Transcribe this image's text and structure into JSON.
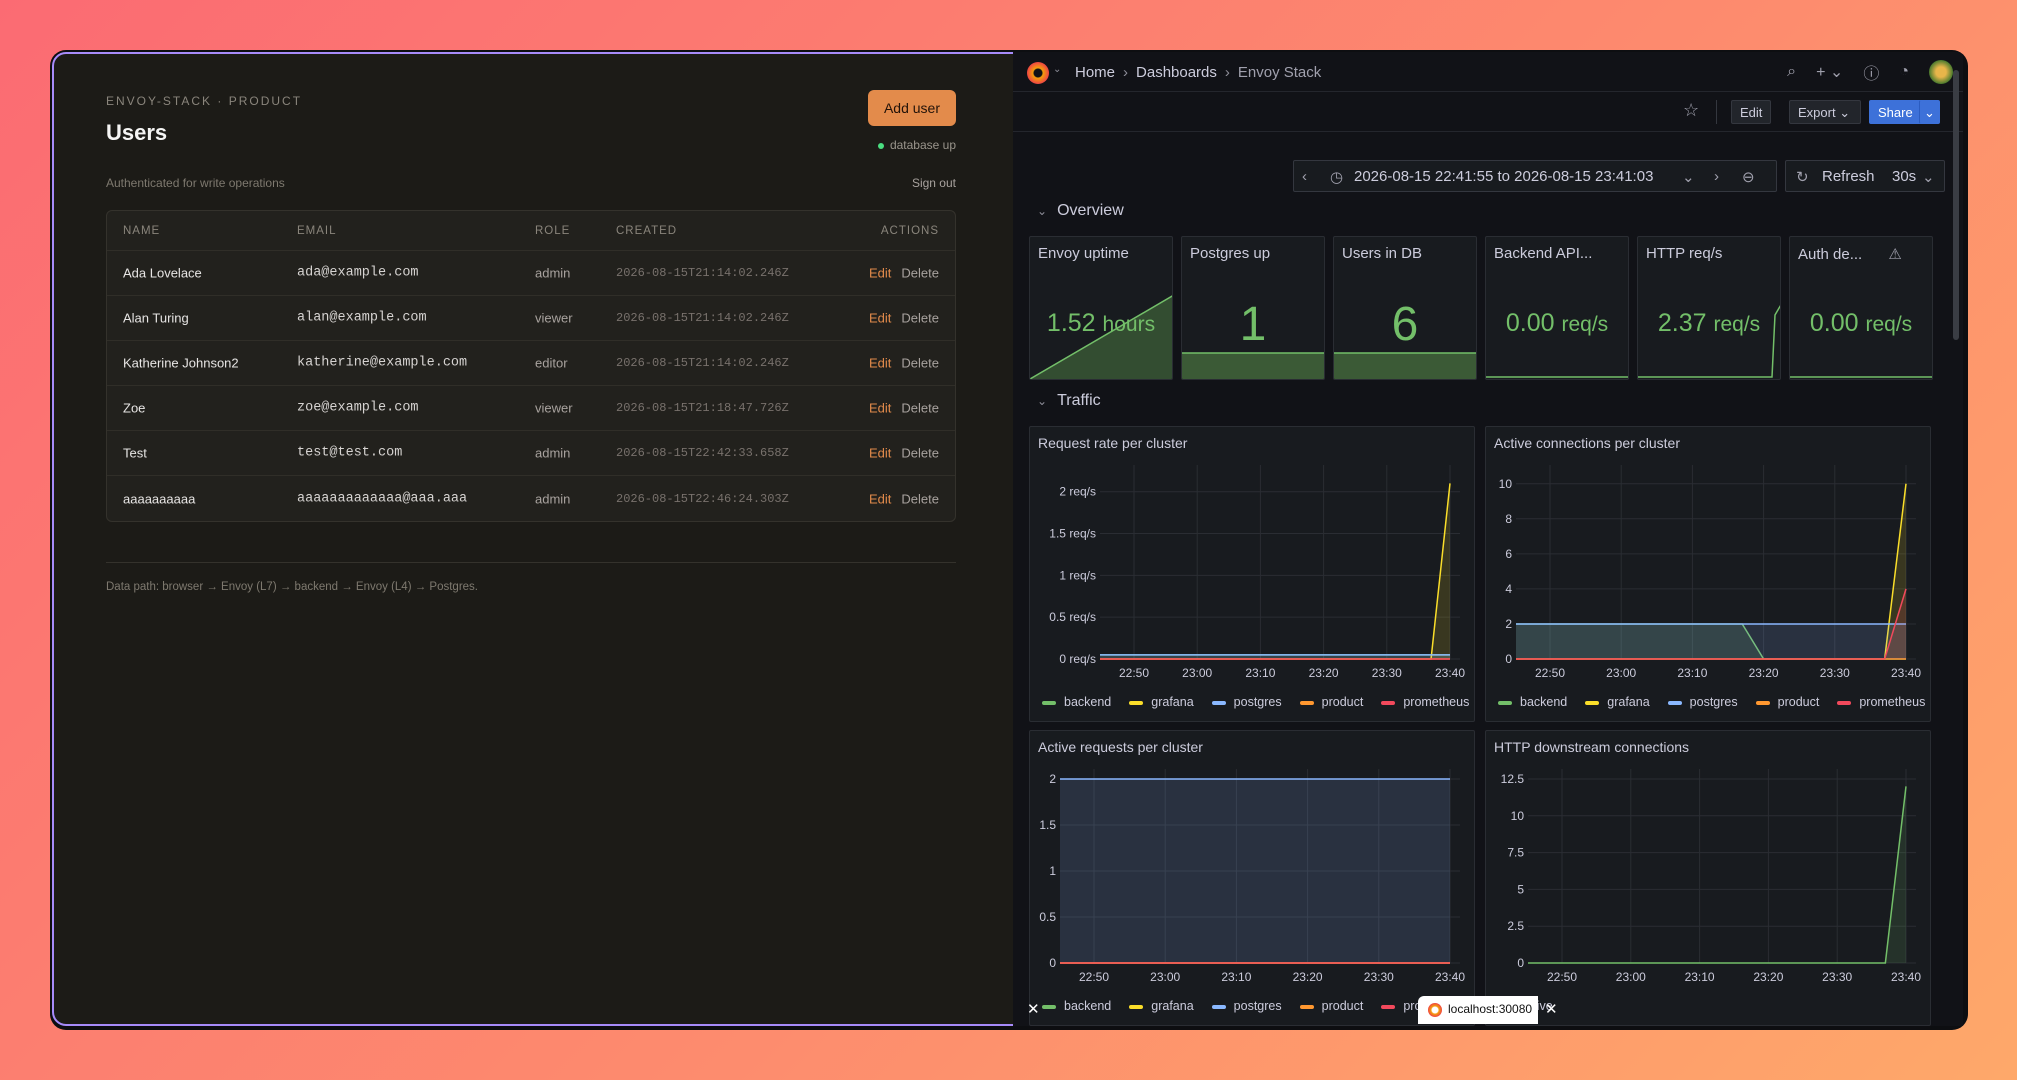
{
  "left": {
    "eyebrow": "ENVOY-STACK · PRODUCT",
    "title": "Users",
    "add_user": "Add user",
    "db_status": "database up",
    "auth_note": "Authenticated for write operations",
    "sign_out": "Sign out",
    "columns": [
      "NAME",
      "EMAIL",
      "ROLE",
      "CREATED",
      "ACTIONS"
    ],
    "rows": [
      {
        "name": "Ada Lovelace",
        "email": "ada@example.com",
        "role": "admin",
        "created": "2026-08-15T21:14:02.246Z"
      },
      {
        "name": "Alan Turing",
        "email": "alan@example.com",
        "role": "viewer",
        "created": "2026-08-15T21:14:02.246Z"
      },
      {
        "name": "Katherine Johnson2",
        "email": "katherine@example.com",
        "role": "editor",
        "created": "2026-08-15T21:14:02.246Z"
      },
      {
        "name": "Zoe",
        "email": "zoe@example.com",
        "role": "viewer",
        "created": "2026-08-15T21:18:47.726Z"
      },
      {
        "name": "Test",
        "email": "test@test.com",
        "role": "admin",
        "created": "2026-08-15T22:42:33.658Z"
      },
      {
        "name": "aaaaaaaaaa",
        "email": "aaaaaaaaaaaaa@aaa.aaa",
        "role": "admin",
        "created": "2026-08-15T22:46:24.303Z"
      }
    ],
    "edit_label": "Edit",
    "delete_label": "Delete",
    "footnote": "Data path: browser → Envoy (L7) → backend → Envoy (L4) → Postgres."
  },
  "grafana": {
    "breadcrumb": [
      "Home",
      "Dashboards",
      "Envoy Stack"
    ],
    "toolbar": {
      "edit": "Edit",
      "export": "Export",
      "share": "Share"
    },
    "time_range": "2026-08-15 22:41:55 to 2026-08-15 23:41:03",
    "refresh": "Refresh",
    "refresh_interval": "30s",
    "sections": {
      "overview": "Overview",
      "traffic": "Traffic"
    },
    "stats": [
      {
        "title": "Envoy uptime",
        "value": "1.52",
        "unit": "hours"
      },
      {
        "title": "Postgres up",
        "value": "1",
        "unit": ""
      },
      {
        "title": "Users in DB",
        "value": "6",
        "unit": ""
      },
      {
        "title": "Backend API...",
        "value": "0.00",
        "unit": "req/s"
      },
      {
        "title": "HTTP req/s",
        "value": "2.37",
        "unit": "req/s"
      },
      {
        "title": "Auth de...",
        "value": "0.00",
        "unit": "req/s"
      }
    ],
    "colors": {
      "backend": "#73bf69",
      "grafana": "#fade2a",
      "postgres": "#8ab8ff",
      "product": "#ff9830",
      "prometheus": "#f2495c",
      "active": "#73bf69"
    },
    "host": "localhost:30080"
  },
  "chart_data": [
    {
      "type": "line",
      "title": "Request rate per cluster",
      "x": [
        "22:50",
        "23:00",
        "23:10",
        "23:20",
        "23:30",
        "23:40"
      ],
      "yticks": [
        "0 req/s",
        "0.5 req/s",
        "1 req/s",
        "1.5 req/s",
        "2 req/s"
      ],
      "ylim": [
        0,
        2.2
      ],
      "series": [
        {
          "name": "backend",
          "values": [
            0.05,
            0.05,
            0.05,
            0.05,
            0.05,
            0.05
          ]
        },
        {
          "name": "grafana",
          "values": [
            0,
            0,
            0,
            0,
            0,
            2.1
          ]
        },
        {
          "name": "postgres",
          "values": [
            0.05,
            0.05,
            0.05,
            0.05,
            0.05,
            0.05
          ]
        },
        {
          "name": "product",
          "values": [
            0,
            0,
            0,
            0,
            0,
            0
          ]
        },
        {
          "name": "prometheus",
          "values": [
            0,
            0,
            0,
            0,
            0,
            0
          ]
        }
      ]
    },
    {
      "type": "line",
      "title": "Active connections per cluster",
      "x": [
        "22:50",
        "23:00",
        "23:10",
        "23:20",
        "23:30",
        "23:40"
      ],
      "yticks": [
        "0",
        "2",
        "4",
        "6",
        "8",
        "10"
      ],
      "ylim": [
        0,
        10.5
      ],
      "series": [
        {
          "name": "backend",
          "values": [
            2,
            2,
            2,
            0,
            0,
            0
          ]
        },
        {
          "name": "grafana",
          "values": [
            0,
            0,
            0,
            0,
            0,
            10
          ]
        },
        {
          "name": "postgres",
          "values": [
            2,
            2,
            2,
            2,
            2,
            2
          ]
        },
        {
          "name": "product",
          "values": [
            0,
            0,
            0,
            0,
            0,
            0
          ]
        },
        {
          "name": "prometheus",
          "values": [
            0,
            0,
            0,
            0,
            0,
            4
          ]
        }
      ]
    },
    {
      "type": "area",
      "title": "Active requests per cluster",
      "x": [
        "22:50",
        "23:00",
        "23:10",
        "23:20",
        "23:30",
        "23:40"
      ],
      "yticks": [
        "0",
        "0.5",
        "1",
        "1.5",
        "2"
      ],
      "ylim": [
        0,
        2
      ],
      "series": [
        {
          "name": "backend",
          "values": [
            0,
            0,
            0,
            0,
            0,
            0
          ]
        },
        {
          "name": "grafana",
          "values": [
            0,
            0,
            0,
            0,
            0,
            0
          ]
        },
        {
          "name": "postgres",
          "values": [
            2,
            2,
            2,
            2,
            2,
            2
          ]
        },
        {
          "name": "product",
          "values": [
            0,
            0,
            0,
            0,
            0,
            0
          ]
        },
        {
          "name": "prometheus",
          "values": [
            0,
            0,
            0,
            0,
            0,
            0
          ]
        }
      ]
    },
    {
      "type": "line",
      "title": "HTTP downstream connections",
      "x": [
        "22:50",
        "23:00",
        "23:10",
        "23:20",
        "23:30",
        "23:40"
      ],
      "yticks": [
        "0",
        "2.5",
        "5",
        "7.5",
        "10",
        "12.5"
      ],
      "ylim": [
        0,
        12.5
      ],
      "series": [
        {
          "name": "active",
          "values": [
            0,
            0,
            0,
            0,
            0,
            12
          ]
        }
      ]
    }
  ]
}
